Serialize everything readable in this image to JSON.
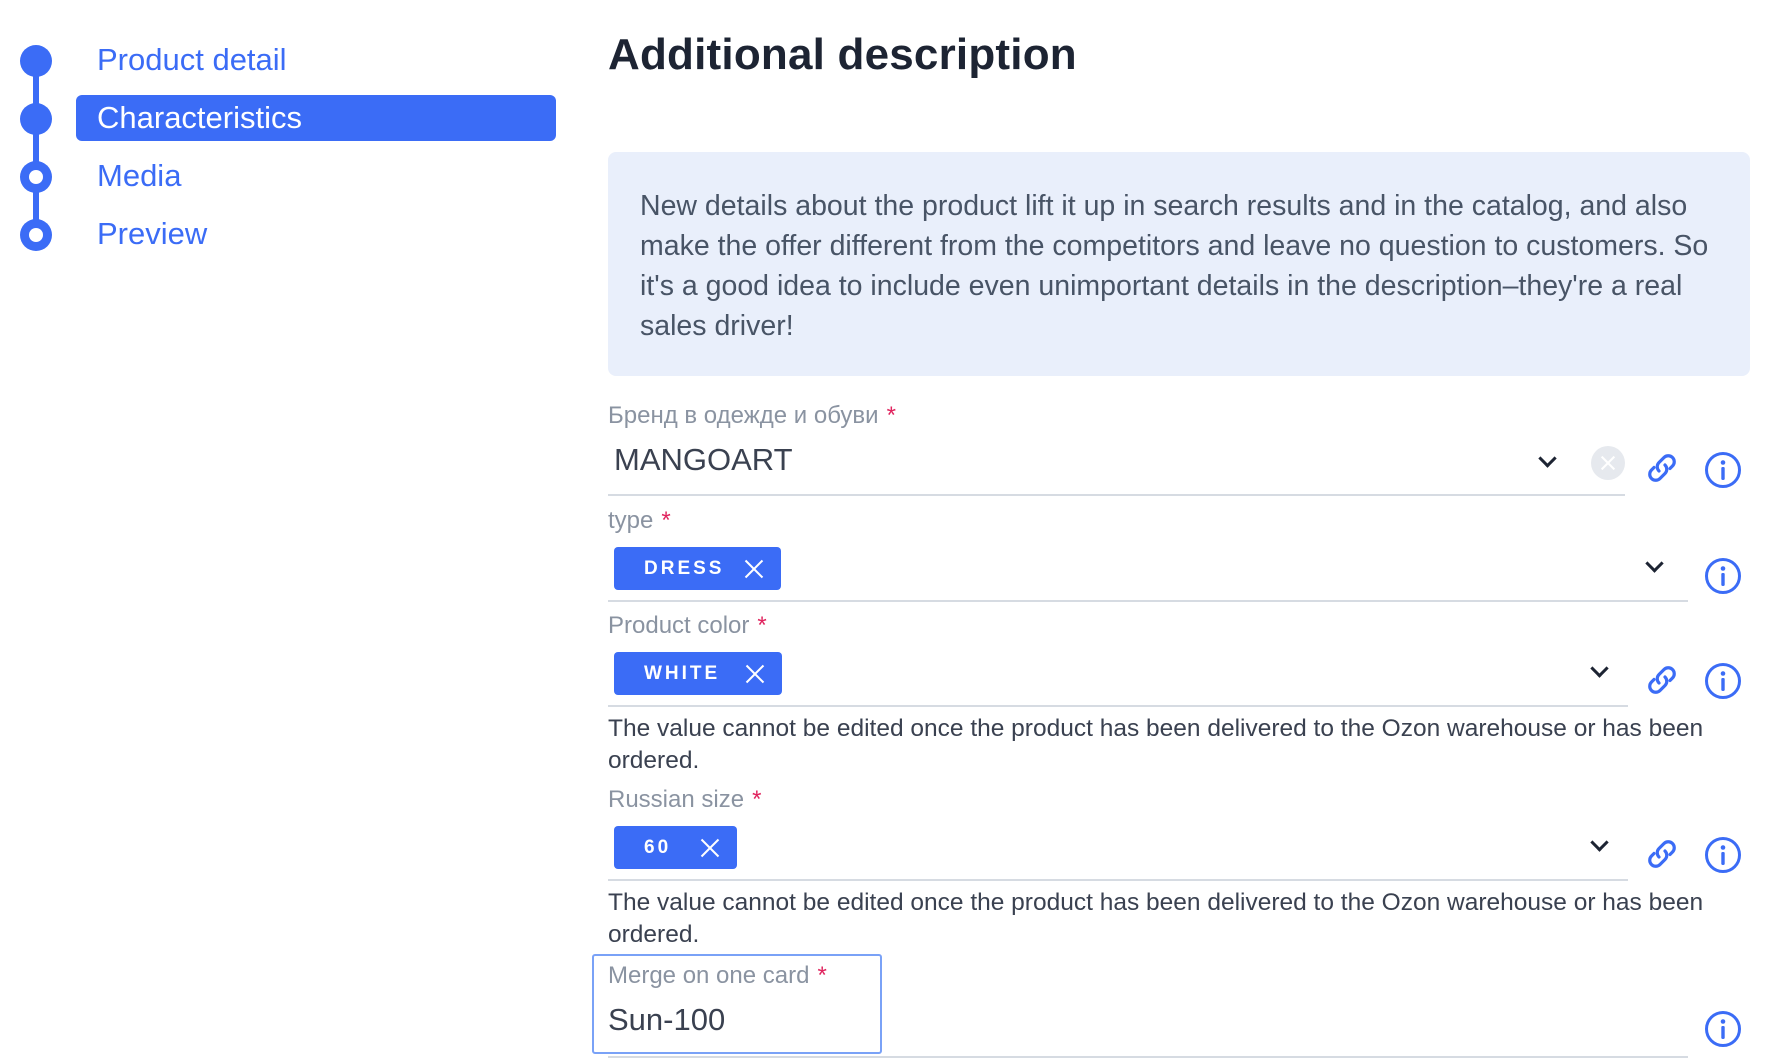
{
  "stepper": {
    "steps": [
      {
        "label": "Product detail",
        "state": "done"
      },
      {
        "label": "Characteristics",
        "state": "active"
      },
      {
        "label": "Media",
        "state": "pending"
      },
      {
        "label": "Preview",
        "state": "pending"
      }
    ]
  },
  "main": {
    "title": "Additional description",
    "banner": "New details about the product lift it up in search results and in the catalog, and also make the offer different from the competitors and leave no question to customers. So it's a good idea to include even unimportant details in the description–they're a real sales driver!",
    "required_mark": "*",
    "fields": {
      "brand": {
        "label": "Бренд в одежде и обуви",
        "value": "MANGOART"
      },
      "type": {
        "label": "type",
        "chips": [
          "DRESS"
        ]
      },
      "color": {
        "label": "Product color",
        "chips": [
          "WHITE"
        ],
        "hint": "The value cannot be edited once the product has been delivered to the Ozon warehouse or has been ordered."
      },
      "size": {
        "label": "Russian size",
        "chips": [
          "60"
        ],
        "hint": "The value cannot be edited once the product has been delivered to the Ozon warehouse or has been ordered."
      },
      "merge": {
        "label": "Merge on one card",
        "value": "Sun-100"
      }
    }
  },
  "colors": {
    "accent": "#3b6cf6",
    "banner_bg": "#e9effb",
    "required": "#e0245e",
    "label": "#8a93a1"
  },
  "icons": [
    "chevron-down-icon",
    "clear-icon",
    "link-icon",
    "info-icon",
    "close-icon"
  ]
}
